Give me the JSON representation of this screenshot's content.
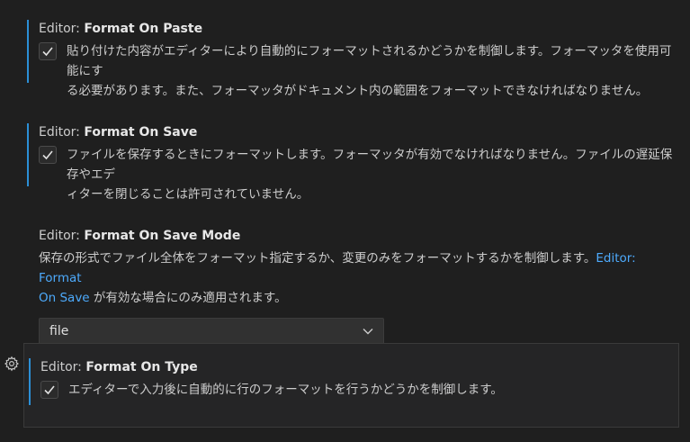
{
  "settings": [
    {
      "category": "Editor: ",
      "name": "Format On Paste",
      "checked": true,
      "description_line1": "貼り付けた内容がエディターにより自動的にフォーマットされるかどうかを制御します。フォーマッタを使用可能にす",
      "description_line2": "る必要があります。また、フォーマッタがドキュメント内の範囲をフォーマットできなければなりません。"
    },
    {
      "category": "Editor: ",
      "name": "Format On Save",
      "checked": true,
      "description_line1": "ファイルを保存するときにフォーマットします。フォーマッタが有効でなければなりません。ファイルの遅延保存やエデ",
      "description_line2": "ィターを閉じることは許可されていません。"
    },
    {
      "category": "Editor: ",
      "name": "Format On Save Mode",
      "description_line1_before_link": "保存の形式でファイル全体をフォーマット指定するか、変更のみをフォーマットするかを制御します。",
      "link_part1": "Editor: Format",
      "link_part2": "On Save",
      "description_line2_after_link": " が有効な場合にのみ適用されます。",
      "select_value": "file"
    },
    {
      "category": "Editor: ",
      "name": "Format On Type",
      "checked": true,
      "description_line1": "エディターで入力後に自動的に行のフォーマットを行うかどうかを制御します。"
    }
  ],
  "icons": {
    "check": "check-icon",
    "chevron": "chevron-down-icon",
    "gear": "gear-icon"
  },
  "colors": {
    "background": "#1f1f1f",
    "modified_indicator": "#2b8fd6",
    "link": "#4daafc"
  }
}
